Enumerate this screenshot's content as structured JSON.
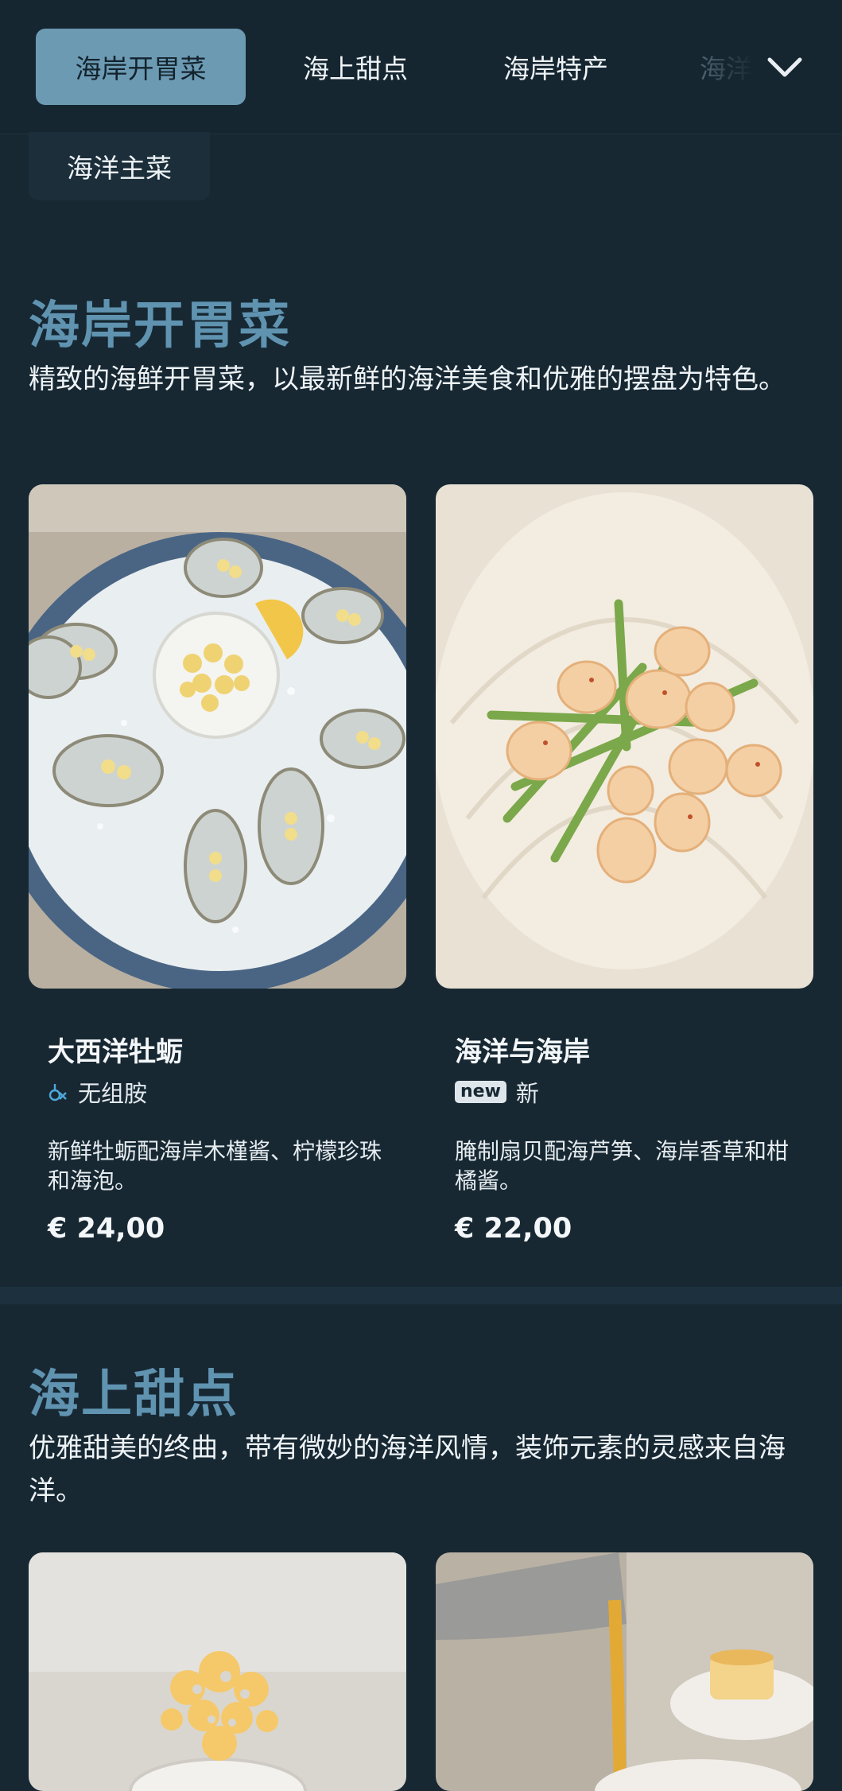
{
  "nav": {
    "tabs": [
      {
        "label": "海岸开胃菜",
        "active": true
      },
      {
        "label": "海上甜点",
        "active": false
      },
      {
        "label": "海岸特产",
        "active": false
      },
      {
        "label": "海洋",
        "active": false
      },
      {
        "label": "海洋主菜",
        "active": false
      }
    ],
    "expand_icon": "chevron-down-icon"
  },
  "sections": [
    {
      "title": "海岸开胃菜",
      "description": "精致的海鲜开胃菜，以最新鲜的海洋美食和优雅的摆盘为特色。",
      "items": [
        {
          "name": "大西洋牡蛎",
          "tag": {
            "icon": "histamine-free-icon",
            "label": "无组胺"
          },
          "description": "新鲜牡蛎配海岸木槿酱、柠檬珍珠和海泡。",
          "price": "€ 24,00"
        },
        {
          "name": "海洋与海岸",
          "tag": {
            "icon": "new-badge",
            "badge": "new",
            "label": "新"
          },
          "description": "腌制扇贝配海芦笋、海岸香草和柑橘酱。",
          "price": "€ 22,00"
        }
      ]
    },
    {
      "title": "海上甜点",
      "description": "优雅甜美的终曲，带有微妙的海洋风情，装饰元素的灵感来自海洋。",
      "items": []
    }
  ],
  "colors": {
    "background": "#172833",
    "accent": "#6c9ab3",
    "section_title": "#5f93b0"
  }
}
